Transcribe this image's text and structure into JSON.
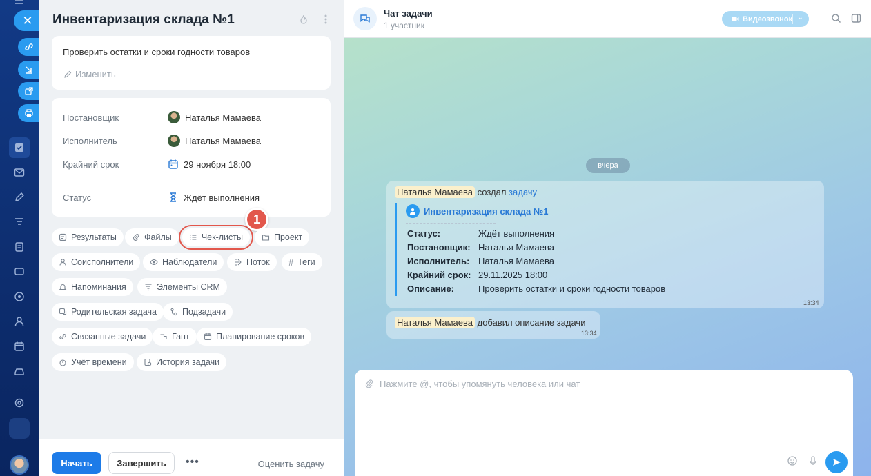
{
  "task": {
    "title": "Инвентаризация склада №1",
    "description": "Проверить остатки и сроки годности товаров",
    "edit_label": "Изменить",
    "fields": {
      "creator_label": "Постановщик",
      "creator_value": "Наталья Мамаева",
      "assignee_label": "Исполнитель",
      "assignee_value": "Наталья Мамаева",
      "deadline_label": "Крайний срок",
      "deadline_value": "29 ноября 18:00",
      "status_label": "Статус",
      "status_value": "Ждёт выполнения"
    },
    "chips": {
      "results": "Результаты",
      "files": "Файлы",
      "checklists": "Чек-листы",
      "project": "Проект",
      "coexecutors": "Соисполнители",
      "observers": "Наблюдатели",
      "flow": "Поток",
      "tags": "Теги",
      "reminders": "Напоминания",
      "crm": "Элементы CRM",
      "parent": "Родительская задача",
      "subtasks": "Подзадачи",
      "related": "Связанные задачи",
      "gantt": "Гант",
      "planning": "Планирование сроков",
      "time_tracking": "Учёт времени",
      "history": "История задачи"
    },
    "callout_number": "1",
    "footer": {
      "start": "Начать",
      "finish": "Завершить",
      "more": "•••",
      "rate": "Оценить задачу"
    }
  },
  "chat": {
    "title": "Чат задачи",
    "subtitle": "1 участник",
    "video_call": "Видеозвонок",
    "day_separator": "вчера",
    "message1": {
      "author": "Наталья Мамаева",
      "action": "создал",
      "link": "задачу",
      "quote_title": "Инвентаризация склада №1",
      "rows": [
        {
          "key": "Статус:",
          "value": "Ждёт выполнения"
        },
        {
          "key": "Постановщик:",
          "value": "Наталья Мамаева"
        },
        {
          "key": "Исполнитель:",
          "value": "Наталья Мамаева"
        },
        {
          "key": "Крайний срок:",
          "value": "29.11.2025 18:00"
        },
        {
          "key": "Описание:",
          "value": "Проверить остатки и сроки годности товаров"
        }
      ],
      "time": "13:34"
    },
    "message2": {
      "author": "Наталья Мамаева",
      "text": "добавил описание задачи",
      "time": "13:34"
    },
    "composer_placeholder": "Нажмите @, чтобы упомянуть человека или чат"
  },
  "icons": {
    "rail": [
      "close-icon",
      "link-icon",
      "download-icon",
      "external-icon",
      "print-icon",
      "tasks-icon",
      "mail-icon",
      "pen-icon",
      "filter-icon",
      "doc-icon",
      "chat-icon",
      "target-icon",
      "people-icon",
      "calendar-icon",
      "car-icon",
      "settings-icon"
    ]
  },
  "colors": {
    "accent": "#2a9bf0",
    "primary_button": "#1d7be8",
    "highlight": "#e2574c"
  }
}
